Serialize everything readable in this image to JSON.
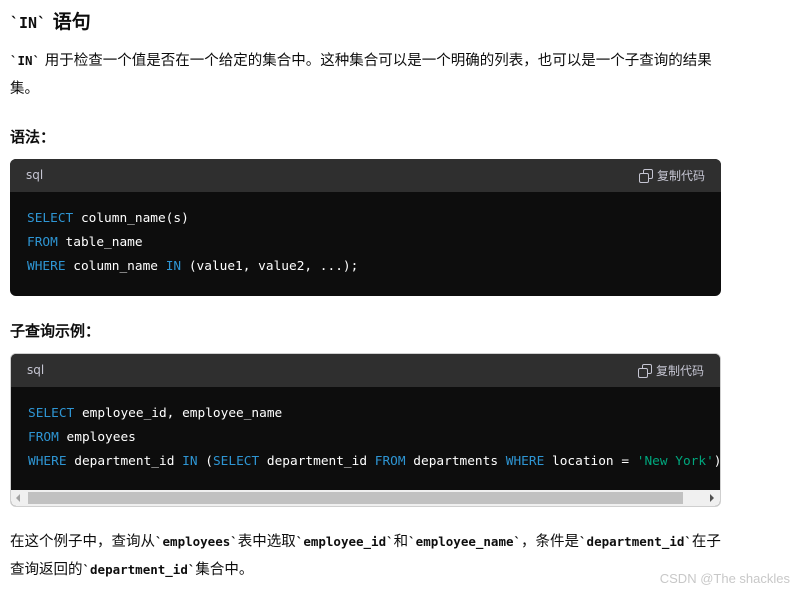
{
  "heading": {
    "code": "`IN`",
    "text": " 语句"
  },
  "intro": {
    "code": "`IN`",
    "text": " 用于检查一个值是否在一个给定的集合中。这种集合可以是一个明确的列表，也可以是一个子查询的结果集。"
  },
  "syntax_heading": "语法：",
  "subquery_heading": "子查询示例：",
  "code_blocks": [
    {
      "language": "sql",
      "copy_label": "复制代码",
      "lines": [
        [
          {
            "t": "SELECT",
            "k": "kw"
          },
          {
            "t": " column_name(s)"
          }
        ],
        [
          {
            "t": "FROM",
            "k": "kw"
          },
          {
            "t": " table_name"
          }
        ],
        [
          {
            "t": "WHERE",
            "k": "kw"
          },
          {
            "t": " column_name "
          },
          {
            "t": "IN",
            "k": "kw"
          },
          {
            "t": " (value1, value2, ...);"
          }
        ]
      ]
    },
    {
      "language": "sql",
      "copy_label": "复制代码",
      "lines": [
        [
          {
            "t": "SELECT",
            "k": "kw"
          },
          {
            "t": " employee_id, employee_name"
          }
        ],
        [
          {
            "t": "FROM",
            "k": "kw"
          },
          {
            "t": " employees"
          }
        ],
        [
          {
            "t": "WHERE",
            "k": "kw"
          },
          {
            "t": " department_id "
          },
          {
            "t": "IN",
            "k": "kw"
          },
          {
            "t": " ("
          },
          {
            "t": "SELECT",
            "k": "kw"
          },
          {
            "t": " department_id "
          },
          {
            "t": "FROM",
            "k": "kw"
          },
          {
            "t": " departments "
          },
          {
            "t": "WHERE",
            "k": "kw"
          },
          {
            "t": " location = "
          },
          {
            "t": "'New York'",
            "k": "str"
          },
          {
            "t": ")"
          }
        ]
      ]
    }
  ],
  "explanation": {
    "parts": [
      {
        "t": "在这个例子中，查询从"
      },
      {
        "t": "`employees`",
        "code": true
      },
      {
        "t": "表中选取"
      },
      {
        "t": "`employee_id`",
        "code": true
      },
      {
        "t": "和"
      },
      {
        "t": "`employee_name`",
        "code": true
      },
      {
        "t": "，条件是"
      },
      {
        "t": "`department_id`",
        "code": true
      },
      {
        "t": "在子查询返回的"
      },
      {
        "t": "`department_id`",
        "code": true
      },
      {
        "t": "集合中。"
      }
    ]
  },
  "watermark": "CSDN @The shackles",
  "colors": {
    "keyword": "#2e95d3",
    "string": "#00a67d",
    "code_bg": "#0d0d0d",
    "code_header_bg": "#2f2f2f"
  }
}
